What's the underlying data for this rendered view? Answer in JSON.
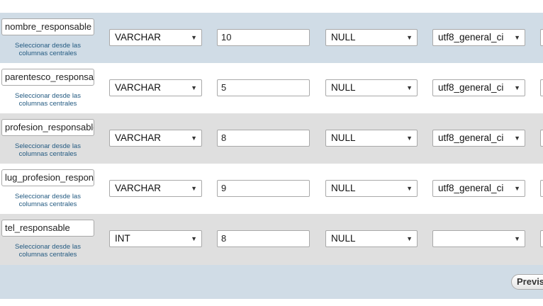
{
  "rows": [
    {
      "name": "nombre_responsable",
      "type": "VARCHAR",
      "length": "10",
      "default": "NULL",
      "collation": "utf8_general_ci",
      "central_link": "Seleccionar desde las columnas centrales"
    },
    {
      "name": "parentesco_responsable",
      "type": "VARCHAR",
      "length": "5",
      "default": "NULL",
      "collation": "utf8_general_ci",
      "central_link": "Seleccionar desde las columnas centrales"
    },
    {
      "name": "profesion_responsable",
      "type": "VARCHAR",
      "length": "8",
      "default": "NULL",
      "collation": "utf8_general_ci",
      "central_link": "Seleccionar desde las columnas centrales"
    },
    {
      "name": "lug_profesion_responsable",
      "type": "VARCHAR",
      "length": "9",
      "default": "NULL",
      "collation": "utf8_general_ci",
      "central_link": "Seleccionar desde las columnas centrales"
    },
    {
      "name": "tel_responsable",
      "type": "INT",
      "length": "8",
      "default": "NULL",
      "collation": "",
      "central_link": "Seleccionar desde las columnas centrales"
    }
  ],
  "footer": {
    "preview_label": "Previsualizar SQL"
  },
  "icons": {
    "dropdown": "chevron-down-icon"
  }
}
